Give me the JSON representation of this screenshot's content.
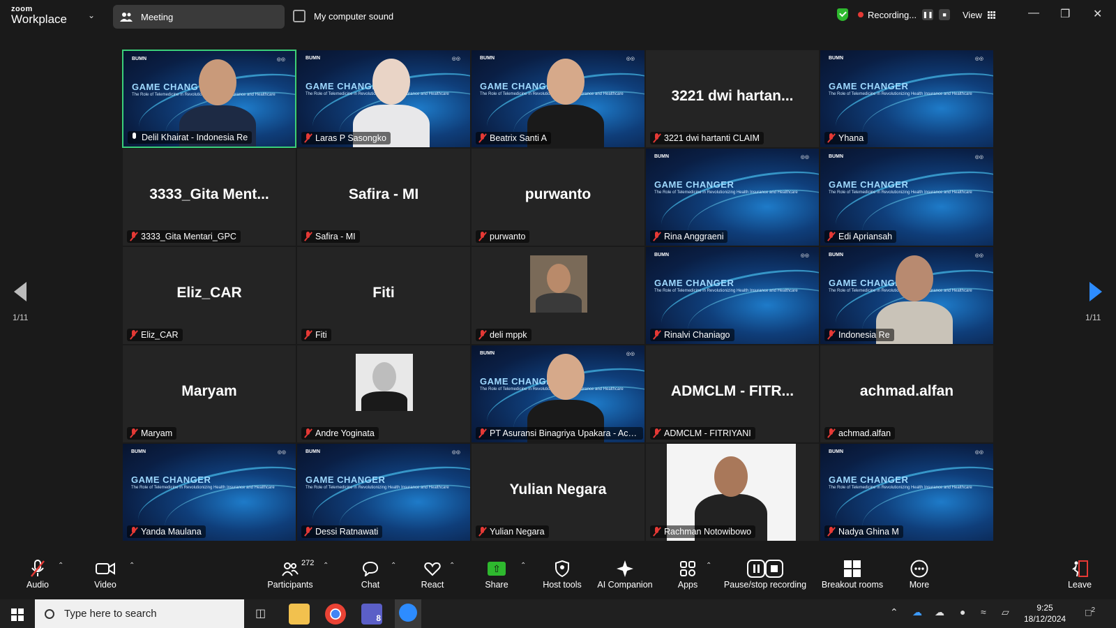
{
  "topbar": {
    "logo_small": "zoom",
    "logo_big": "Workplace",
    "meeting_tab": "Meeting",
    "audio_source": "My computer sound",
    "recording_label": "Recording...",
    "view_label": "View"
  },
  "background": {
    "title": "GAME CHANGER",
    "subtitle": "The Role of Telemedicine in Revolutionizing Health Insurance and Healthcare",
    "org": "BUMN"
  },
  "tiles": [
    {
      "name": "Delil Khairat - Indonesia Re",
      "kind": "video-bg",
      "speaker": true,
      "muted": false,
      "title": "GAME CHANG"
    },
    {
      "name": "Laras P Sasongko",
      "kind": "video-bg",
      "muted": true
    },
    {
      "name": "Beatrix Santi A",
      "kind": "video-bg",
      "muted": true
    },
    {
      "name": "3221 dwi hartanti CLAIM",
      "kind": "name",
      "display": "3221  dwi  hartan...",
      "muted": true
    },
    {
      "name": "Yhana",
      "kind": "bg",
      "muted": true
    },
    {
      "name": "3333_Gita Mentari_GPC",
      "kind": "name",
      "display": "3333_Gita  Ment...",
      "muted": true
    },
    {
      "name": "Safira - MI",
      "kind": "name",
      "display": "Safira - MI",
      "muted": true
    },
    {
      "name": "purwanto",
      "kind": "name",
      "display": "purwanto",
      "muted": true
    },
    {
      "name": "Rina Anggraeni",
      "kind": "bg",
      "muted": true
    },
    {
      "name": "Edi Apriansah",
      "kind": "bg",
      "muted": true
    },
    {
      "name": "Eliz_CAR",
      "kind": "name",
      "display": "Eliz_CAR",
      "muted": true
    },
    {
      "name": "Fiti",
      "kind": "name",
      "display": "Fiti",
      "muted": true
    },
    {
      "name": "deli mppk",
      "kind": "avatar",
      "muted": true
    },
    {
      "name": "Rinalvi Chaniago",
      "kind": "bg",
      "muted": true
    },
    {
      "name": "Indonesia Re",
      "kind": "video-bg",
      "muted": true
    },
    {
      "name": "Maryam",
      "kind": "name",
      "display": "Maryam",
      "muted": true
    },
    {
      "name": "Andre Yoginata",
      "kind": "avatar-bw",
      "muted": true
    },
    {
      "name": "PT Asuransi Binagriya Upakara - Ach...",
      "kind": "video-bg",
      "muted": true
    },
    {
      "name": "ADMCLM - FITRIYANI",
      "kind": "name",
      "display": "ADMCLM  -  FITR...",
      "muted": true
    },
    {
      "name": "achmad.alfan",
      "kind": "name",
      "display": "achmad.alfan",
      "muted": true
    },
    {
      "name": "Yanda Maulana",
      "kind": "bg",
      "muted": true
    },
    {
      "name": "Dessi Ratnawati",
      "kind": "bg",
      "muted": true
    },
    {
      "name": "Yulian Negara",
      "kind": "name",
      "display": "Yulian Negara",
      "muted": true
    },
    {
      "name": "Rachman Notowibowo",
      "kind": "photo",
      "muted": true
    },
    {
      "name": "Nadya Ghina M",
      "kind": "bg",
      "muted": true
    }
  ],
  "pager": {
    "left": "1/11",
    "right": "1/11"
  },
  "toolbar": {
    "audio": "Audio",
    "video": "Video",
    "participants": "Participants",
    "participants_count": "272",
    "chat": "Chat",
    "react": "React",
    "share": "Share",
    "host_tools": "Host tools",
    "ai_companion": "AI Companion",
    "apps": "Apps",
    "pause_stop": "Pause/stop recording",
    "breakout": "Breakout rooms",
    "more": "More",
    "leave": "Leave"
  },
  "taskbar": {
    "search_placeholder": "Type here to search",
    "time": "9:25",
    "date": "18/12/2024",
    "teams_badge": "8",
    "notif_count": "2"
  },
  "colors": {
    "accent_green": "#3ad07a",
    "mute_red": "#e53935",
    "zoom_blue": "#2d8cff"
  }
}
